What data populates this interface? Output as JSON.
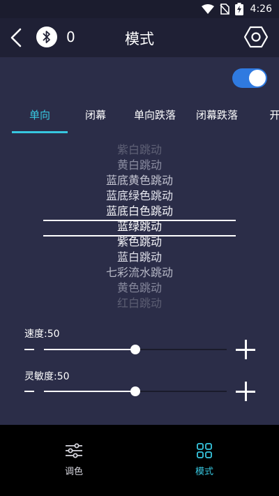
{
  "status_bar": {
    "time": "4:26",
    "icons": [
      "wifi-icon",
      "no-sim-icon",
      "battery-charging-icon"
    ]
  },
  "header": {
    "title": "模式",
    "device_count": "0",
    "icons": [
      "back-icon",
      "bluetooth-icon",
      "settings-icon"
    ]
  },
  "toggle": {
    "state": "on",
    "color": "#2f7ae0"
  },
  "tabs": [
    {
      "label": "单向",
      "active": true
    },
    {
      "label": "闭幕",
      "active": false
    },
    {
      "label": "单向跌落",
      "active": false
    },
    {
      "label": "闭幕跌落",
      "active": false
    },
    {
      "label": "开",
      "active": false
    }
  ],
  "accent_color": "#37c7e0",
  "modes": {
    "items": [
      "紫白跳动",
      "黄白跳动",
      "蓝底黄色跳动",
      "蓝底绿色跳动",
      "蓝底白色跳动",
      "蓝绿跳动",
      "紫色跳动",
      "蓝白跳动",
      "七彩流水跳动",
      "黄色跳动",
      "红白跳动"
    ],
    "selected": "蓝绿跳动"
  },
  "speed": {
    "label": "速度:50",
    "value": 50,
    "max": 100
  },
  "sensitivity": {
    "label": "灵敏度:50",
    "value": 50,
    "max": 100
  },
  "bottom_nav": [
    {
      "label": "调色",
      "icon": "sliders-icon",
      "active": false
    },
    {
      "label": "模式",
      "icon": "grid-icon",
      "active": true
    }
  ]
}
